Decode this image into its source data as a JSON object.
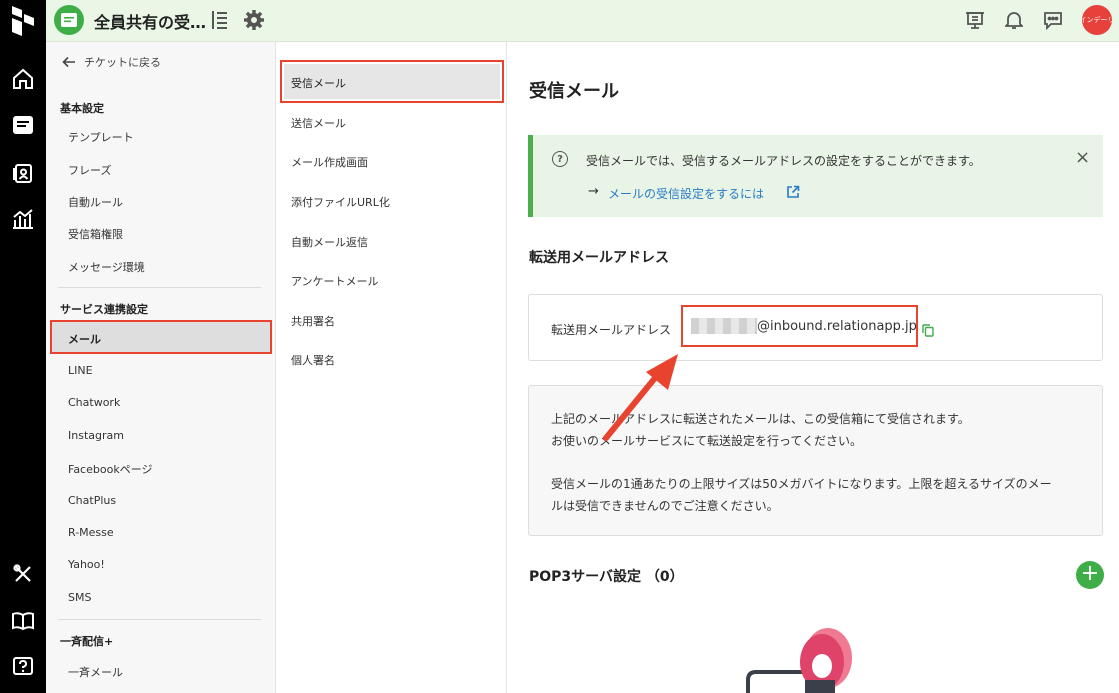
{
  "topbar": {
    "inbox_title": "全員共有の受…",
    "avatar_text": "インデーリ"
  },
  "rail": {
    "icons": [
      "home-icon",
      "inbox-icon",
      "contacts-icon",
      "analytics-icon",
      "tools-icon",
      "book-icon",
      "help-icon"
    ]
  },
  "sidebar": {
    "back_label": "チケットに戻る",
    "section_basic": "基本設定",
    "basic_items": [
      "テンプレート",
      "フレーズ",
      "自動ルール",
      "受信箱権限",
      "メッセージ環境"
    ],
    "section_service": "サービス連携設定",
    "active_item": "メール",
    "service_items": [
      "LINE",
      "Chatwork",
      "Instagram",
      "Facebookページ",
      "ChatPlus",
      "R-Messe",
      "Yahoo!",
      "SMS"
    ],
    "section_broadcast": "一斉配信+",
    "broadcast_items": [
      "一斉メール"
    ]
  },
  "submenu": {
    "active_item": "受信メール",
    "items": [
      "送信メール",
      "メール作成画面",
      "添付ファイルURL化",
      "自動メール返信",
      "アンケートメール",
      "共用署名",
      "個人署名"
    ]
  },
  "main": {
    "title": "受信メール",
    "info": {
      "message": "受信メールでは、受信するメールアドレスの設定をすることができます。",
      "arrow": "→",
      "link": "メールの受信設定をするには",
      "close": "×"
    },
    "forward_section_title": "転送用メールアドレス",
    "forward_label": "転送用メールアドレス",
    "forward_domain": "@inbound.relationapp.jp",
    "note_lines": [
      "上記のメールアドレスに転送されたメールは、この受信箱にて受信されます。",
      "お使いのメールサービスにて転送設定を行ってください。",
      "受信メールの1通あたりの上限サイズは50メガバイトになります。上限を超えるサイズのメー",
      "ルは受信できませんのでご注意ください。"
    ],
    "pop3_title": "POP3サーバ設定 （0）",
    "add_button": "+"
  },
  "colors": {
    "brand_green": "#3fae49",
    "highlight_red": "#e8432e",
    "link_blue": "#2a7ac7",
    "info_bg": "#e8f5e6"
  }
}
